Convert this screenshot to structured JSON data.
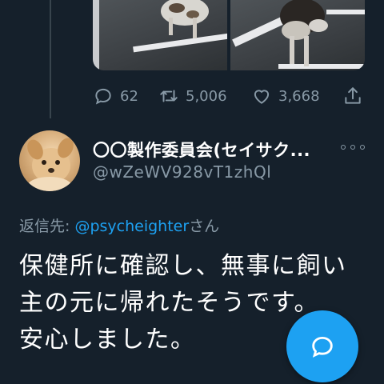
{
  "tweet_actions": {
    "reply_count": "62",
    "retweet_count": "5,006",
    "like_count": "3,668"
  },
  "reply": {
    "author_name": "〇〇製作委員会(セイサク...",
    "author_handle": "@wZeWV928vT1zhQl",
    "replying_to_label": "返信先:",
    "replying_to_mention": "@psycheighter",
    "replying_to_suffix": "さん",
    "text_lines": [
      "保健所に確認し、無事に飼い",
      "主の元に帰れたそうです。",
      "安心しました。"
    ]
  },
  "icons": {
    "reply": "reply-icon",
    "retweet": "retweet-icon",
    "like": "heart-icon",
    "share": "share-icon",
    "more": "more-icon",
    "compose": "compose-reply-icon"
  },
  "colors": {
    "background": "#15202b",
    "muted": "#8899a6",
    "accent": "#1da1f2"
  }
}
